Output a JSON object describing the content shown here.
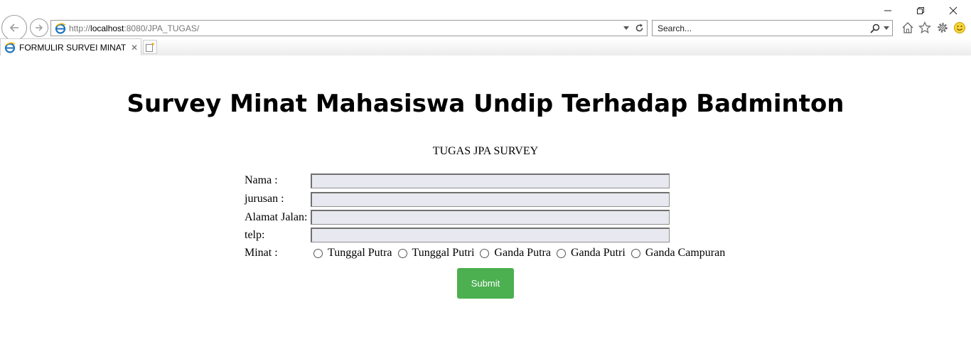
{
  "browser": {
    "address": {
      "scheme": "http://",
      "host": "localhost",
      "rest": ":8080/JPA_TUGAS/"
    },
    "search_placeholder": "Search...",
    "tab": {
      "title": "FORMULIR SURVEI MINAT ...",
      "close": "✕"
    },
    "icons": [
      "back-icon",
      "forward-icon",
      "ie-icon",
      "refresh-icon",
      "search-icon",
      "home-icon",
      "star-icon",
      "gear-icon",
      "smiley-icon",
      "new-tab-icon"
    ],
    "accent": "#1e73be"
  },
  "page": {
    "title": "Survey Minat Mahasiswa Undip Terhadap Badminton",
    "subtitle": "TUGAS JPA SURVEY",
    "form": {
      "labels": {
        "nama": "Nama :",
        "jurusan": "jurusan :",
        "alamat": "Alamat Jalan:",
        "telp": "telp:",
        "minat": "Minat :"
      },
      "values": {
        "nama": "",
        "jurusan": "",
        "alamat": "",
        "telp": ""
      },
      "minat_options": [
        "Tunggal Putra",
        "Tunggal Putri",
        "Ganda Putra",
        "Ganda Putri",
        "Ganda Campuran"
      ],
      "submit": "Submit"
    },
    "colors": {
      "submit_bg": "#4caf50",
      "input_bg": "#e8e8f0"
    }
  }
}
